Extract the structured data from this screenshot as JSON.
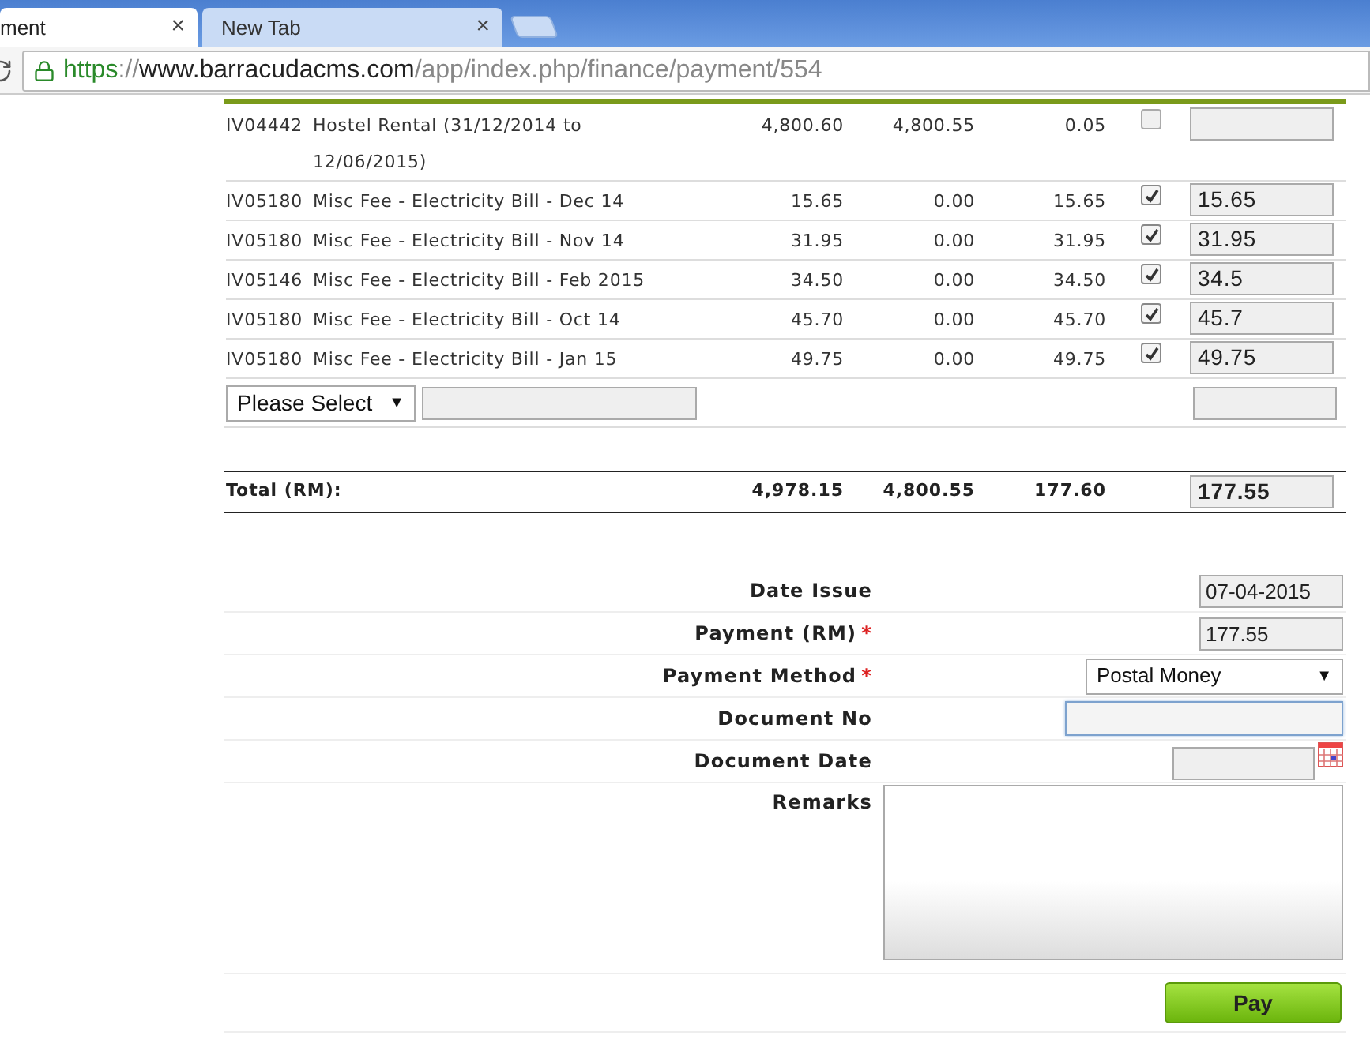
{
  "browser": {
    "tabs": [
      {
        "title": "ment",
        "selected": true
      },
      {
        "title": "New Tab",
        "selected": false
      }
    ],
    "close_glyph": "×",
    "url": {
      "scheme": "https",
      "separator": "://",
      "host": "www.barracudacms.com",
      "path": "/app/index.php/finance/payment/554"
    }
  },
  "invoices": [
    {
      "invoice": "IV04442",
      "description": "Hostel Rental (31/12/2014 to 12/06/2015)",
      "amount": "4,800.60",
      "paid": "4,800.55",
      "balance": "0.05",
      "checked": false
    },
    {
      "invoice": "IV05180",
      "description": "Misc Fee - Electricity Bill - Dec 14",
      "amount": "15.65",
      "paid": "0.00",
      "balance": "15.65",
      "checked": true,
      "pay": "15.65"
    },
    {
      "invoice": "IV05180",
      "description": "Misc Fee - Electricity Bill - Nov 14",
      "amount": "31.95",
      "paid": "0.00",
      "balance": "31.95",
      "checked": true,
      "pay": "31.95"
    },
    {
      "invoice": "IV05146",
      "description": "Misc Fee - Electricity Bill - Feb 2015",
      "amount": "34.50",
      "paid": "0.00",
      "balance": "34.50",
      "checked": true,
      "pay": "34.5"
    },
    {
      "invoice": "IV05180",
      "description": "Misc Fee - Electricity Bill - Oct 14",
      "amount": "45.70",
      "paid": "0.00",
      "balance": "45.70",
      "checked": true,
      "pay": "45.7"
    },
    {
      "invoice": "IV05180",
      "description": "Misc Fee - Electricity Bill - Jan 15",
      "amount": "49.75",
      "paid": "0.00",
      "balance": "49.75",
      "checked": true,
      "pay": "49.75"
    }
  ],
  "extra_row": {
    "select": "Please Select",
    "caret": "▼"
  },
  "total": {
    "label": "Total (RM):",
    "amount": "4,978.15",
    "paid": "4,800.55",
    "balance": "177.60",
    "pay": "177.55"
  },
  "form": [
    {
      "kind": "input",
      "label": "Date Issue",
      "required": false,
      "value": "07-04-2015"
    },
    {
      "kind": "input",
      "label": "Payment (RM)",
      "required": true,
      "value": "177.55"
    },
    {
      "kind": "select",
      "label": "Payment Method",
      "required": true,
      "value": "Postal Money"
    },
    {
      "kind": "focused",
      "label": "Document No",
      "required": false
    },
    {
      "kind": "date",
      "label": "Document Date",
      "required": false
    },
    {
      "kind": "textarea",
      "label": "Remarks",
      "required": false
    }
  ],
  "required_mark": "*",
  "pay_button": "Pay"
}
